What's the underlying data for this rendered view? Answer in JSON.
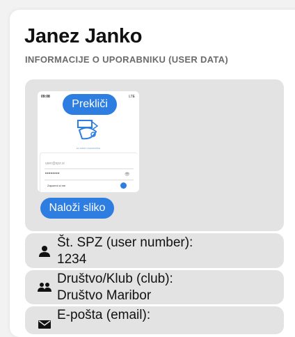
{
  "user": {
    "name": "Janez Janko",
    "subtitle": "INFORMACIJE O UPORABNIKU (USER DATA)"
  },
  "photo": {
    "cancel_label": "Prekliči",
    "upload_label": "Naloži sliko",
    "preview": {
      "time": "09:08",
      "status_right": "LTE",
      "logo_caption": "ZA VARNO ZVEZDNIŠKE",
      "username_placeholder": "user@spz.si",
      "password_mask": "••••••••",
      "remember_label": "Zapomni si me"
    }
  },
  "fields": [
    {
      "label": "Št. SPZ (user number):",
      "value": "1234",
      "icon": "person-icon"
    },
    {
      "label": "Društvo/Klub (club):",
      "value": "Društvo Maribor",
      "icon": "group-icon"
    },
    {
      "label": "E-pošta (email):",
      "value": "",
      "icon": "mail-icon"
    }
  ],
  "colors": {
    "accent": "#2e7de1",
    "panel": "#e3e3e3",
    "card": "#ffffff"
  }
}
